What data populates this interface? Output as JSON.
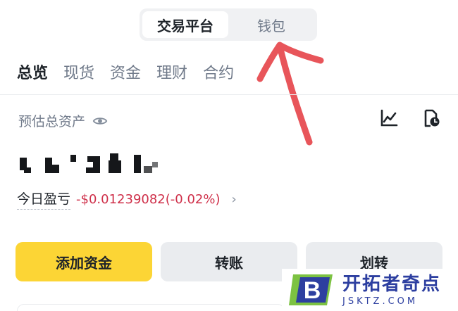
{
  "segment": {
    "tabs": [
      {
        "label": "交易平台",
        "active": true
      },
      {
        "label": "钱包",
        "active": false
      }
    ]
  },
  "subtabs": [
    "总览",
    "现货",
    "资金",
    "理财",
    "合约"
  ],
  "assets": {
    "label": "预估总资产",
    "pnl_label": "今日盈亏",
    "pnl_value": "-$0.01239082(-0.02%)"
  },
  "actions": {
    "add_funds": "添加资金",
    "transfer": "转账",
    "move": "划转"
  },
  "watermark": {
    "title": "开拓者奇点",
    "url": "JSKTZ.COM"
  },
  "colors": {
    "accent_yellow": "#fcd535",
    "loss_red": "#cf304a",
    "annotation_red": "#e8555a",
    "watermark_blue": "#2d3fa0",
    "watermark_green": "#7cc242"
  },
  "icons": [
    "eye-icon",
    "chart-icon",
    "history-icon",
    "chevron-right-icon"
  ]
}
